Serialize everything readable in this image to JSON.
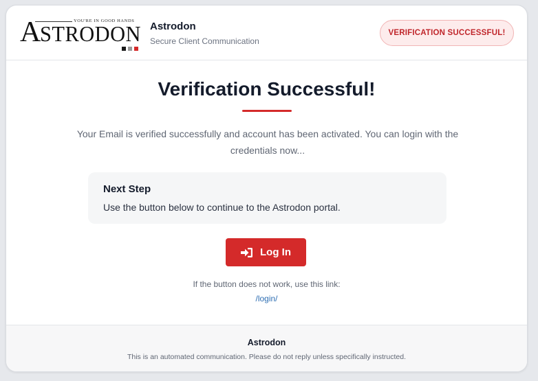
{
  "header": {
    "logo": {
      "tagline": "YOU'RE IN GOOD HANDS",
      "wordmark": "ASTRODON",
      "square_colors": [
        "#1a1a1a",
        "#9a9a9a",
        "#d42a2a"
      ]
    },
    "brand_name": "Astrodon",
    "brand_subtitle": "Secure Client Communication",
    "status_badge": "VERIFICATION SUCCESSFUL!"
  },
  "main": {
    "title": "Verification Successful!",
    "message": "Your Email is verified successfully and account has been activated. You can login with the credentials now...",
    "next_step": {
      "title": "Next Step",
      "body": "Use the button below to continue to the Astrodon portal."
    },
    "login_button": {
      "label": "Log In",
      "icon": "sign-in-icon"
    },
    "fallback_text": "If the button does not work, use this link:",
    "fallback_link": "/login/"
  },
  "footer": {
    "title": "Astrodon",
    "note": "This is an automated communication. Please do not reply unless specifically instructed."
  },
  "colors": {
    "accent": "#d42a2a",
    "badge_bg": "#fdecec",
    "link": "#2f6fb3"
  }
}
